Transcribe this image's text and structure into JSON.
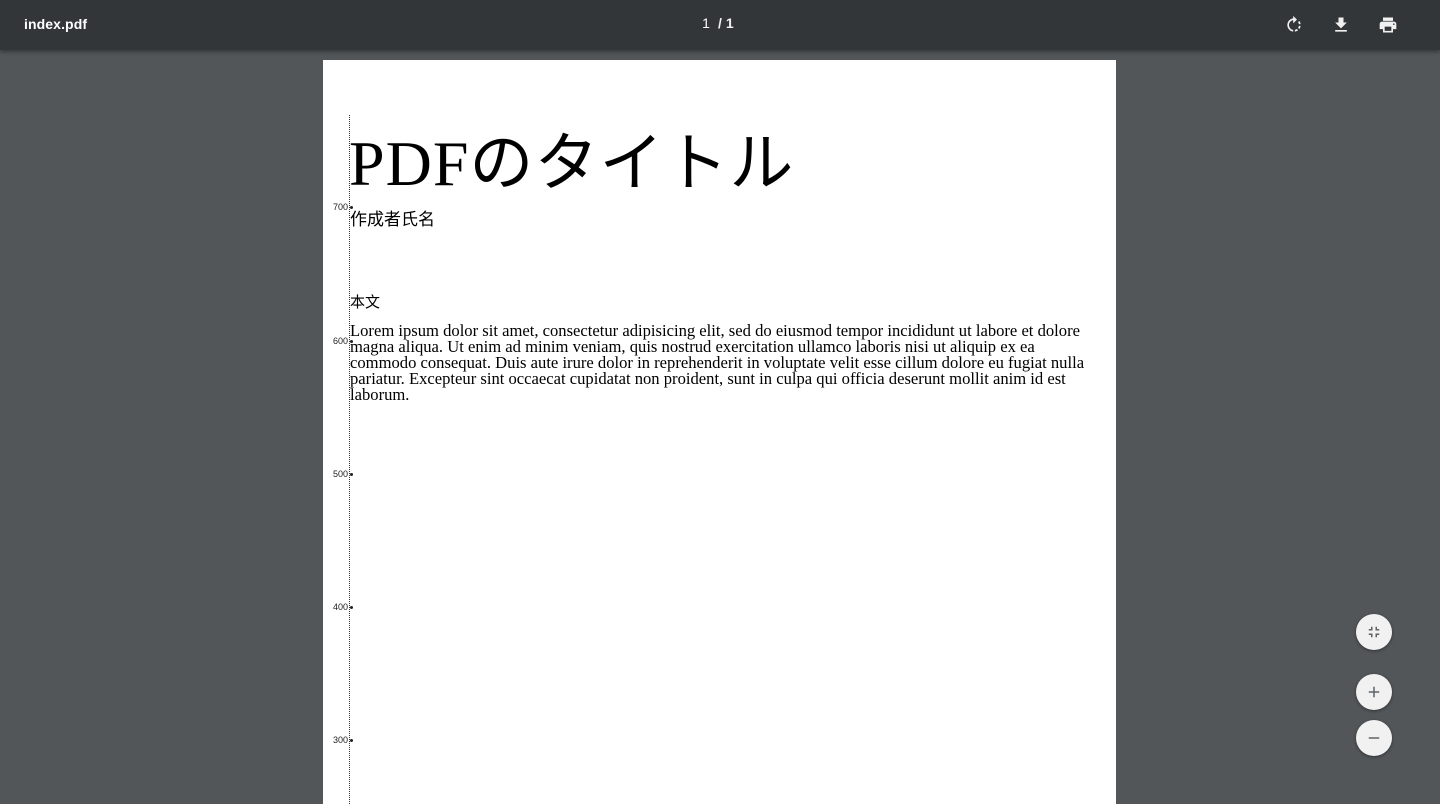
{
  "toolbar": {
    "title": "index.pdf",
    "page_current": "1",
    "page_separator": "/",
    "page_total": "1",
    "buttons": [
      "rotate-icon",
      "download-icon",
      "print-icon"
    ]
  },
  "document": {
    "title": "PDFのタイトル",
    "author": "作成者氏名",
    "body_heading": "本文",
    "body_text": "Lorem ipsum dolor sit amet, consectetur adipisicing elit, sed do eiusmod tempor incididunt ut labore et dolore magna aliqua. Ut enim ad minim veniam, quis nostrud exercitation ullamco laboris nisi ut aliquip ex ea commodo consequat. Duis aute irure dolor in reprehenderit in voluptate velit esse cillum dolore eu fugiat nulla pariatur. Excepteur sint occaecat cupidatat non proident, sunt in culpa qui officia deserunt mollit anim id est laborum.",
    "ruler_ticks": [
      "700",
      "600",
      "500",
      "400",
      "300"
    ]
  },
  "controls": {
    "fit_icon": "fit-to-page-icon",
    "zoom_in_icon": "plus-icon",
    "zoom_out_icon": "minus-icon"
  },
  "colors": {
    "toolbar_bg": "#323639",
    "viewer_bg": "#525659",
    "page_bg": "#ffffff"
  }
}
